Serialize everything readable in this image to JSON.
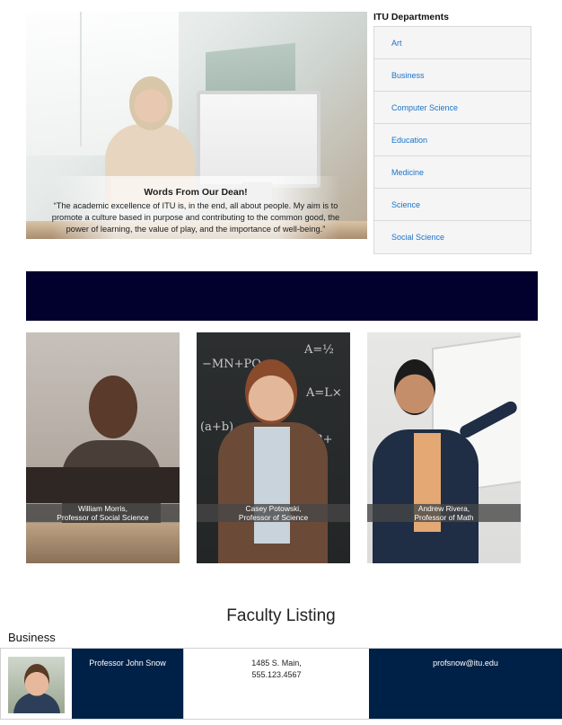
{
  "dean": {
    "title": "Words From Our Dean!",
    "quote": "“The academic excellence of ITU is, in the end, all about people. My aim is to promote a culture based in purpose and contributing to the common good, the power of learning, the value of play, and the importance of well-being.”"
  },
  "departments": {
    "heading": "ITU Departments",
    "items": [
      "Art",
      "Business",
      "Computer Science",
      "Education",
      "Medicine",
      "Science",
      "Social Science"
    ]
  },
  "faculty_cards": [
    {
      "name": "William Morris,",
      "role": "Professor of Social Science"
    },
    {
      "name": "Casey Potowski,",
      "role": "Professor of Science"
    },
    {
      "name": "Andrew Rivera,",
      "role": "Professor of Math"
    }
  ],
  "listing": {
    "title": "Faculty Listing",
    "department": "Business",
    "rows": [
      {
        "name": "Professor John Snow",
        "address_line1": "1485 S. Main,",
        "address_line2": "555.123.4567",
        "email": "profsnow@itu.edu"
      }
    ]
  },
  "colors": {
    "banner": "#02012d",
    "link": "#1a73c9",
    "listing_dark": "#002147"
  }
}
